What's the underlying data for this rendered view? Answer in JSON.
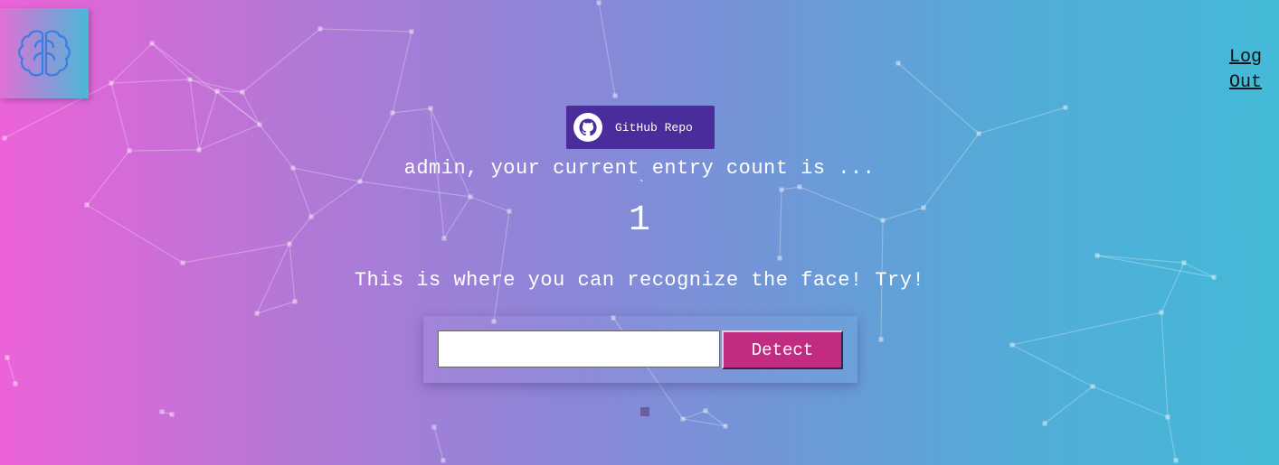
{
  "nav": {
    "logo_icon": "brain-icon",
    "logout_label": "Log Out"
  },
  "github": {
    "label": "GitHub Repo",
    "icon": "github-icon",
    "color": "#4a2d9a"
  },
  "rank": {
    "greeting": "admin, your current entry count is ...",
    "count": "1"
  },
  "form": {
    "subtitle": "This is where you can recognize the face! Try!",
    "input_value": "",
    "input_placeholder": "",
    "detect_label": "Detect",
    "detect_color": "#c12b82"
  },
  "theme": {
    "gradient_start": "#ec62d9",
    "gradient_end": "#44bad8"
  }
}
